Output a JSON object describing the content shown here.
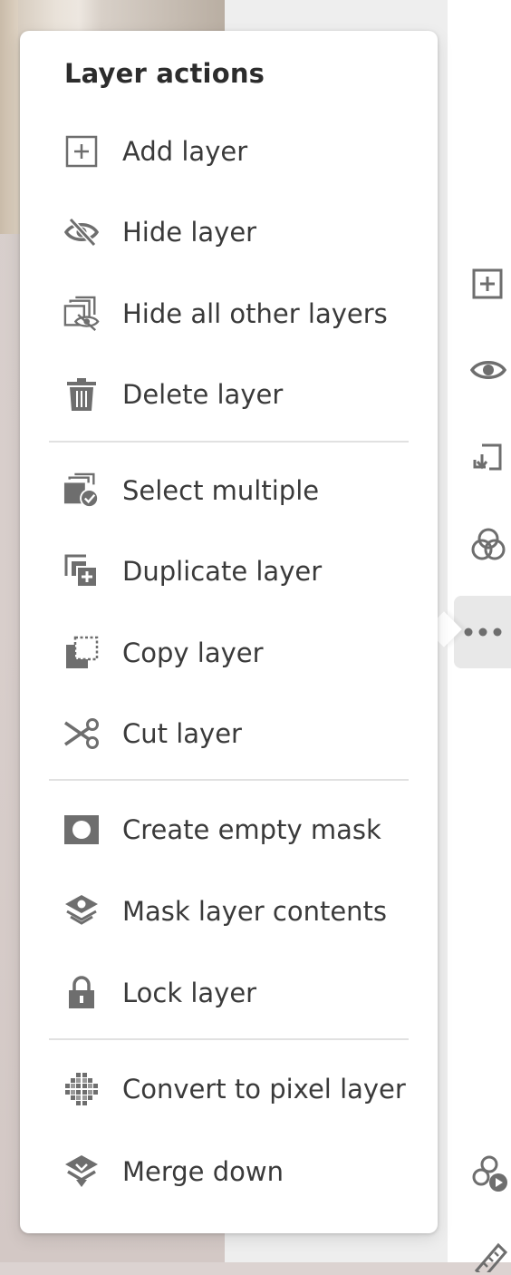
{
  "menu": {
    "title": "Layer actions",
    "items": [
      {
        "label": "Add layer",
        "icon": "add-layer-icon"
      },
      {
        "label": "Hide layer",
        "icon": "hide-layer-icon"
      },
      {
        "label": "Hide all other layers",
        "icon": "hide-others-icon"
      },
      {
        "label": "Delete layer",
        "icon": "trash-icon"
      },
      {
        "label": "Select multiple",
        "icon": "select-multiple-icon"
      },
      {
        "label": "Duplicate layer",
        "icon": "duplicate-icon"
      },
      {
        "label": "Copy layer",
        "icon": "copy-icon"
      },
      {
        "label": "Cut layer",
        "icon": "scissors-icon"
      },
      {
        "label": "Create empty mask",
        "icon": "mask-icon"
      },
      {
        "label": "Mask layer contents",
        "icon": "mask-contents-icon"
      },
      {
        "label": "Lock layer",
        "icon": "lock-icon"
      },
      {
        "label": "Convert to pixel layer",
        "icon": "pixel-layer-icon"
      },
      {
        "label": "Merge down",
        "icon": "merge-down-icon"
      }
    ]
  },
  "toolbar": {
    "icons": [
      "add-layer-icon",
      "eye-icon",
      "import-icon",
      "blend-icon",
      "more-icon",
      "effects-icon",
      "ruler-icon"
    ]
  },
  "colors": {
    "icon": "#6e6e6e",
    "text": "#3a3a3a",
    "title": "#2c2c2c"
  }
}
